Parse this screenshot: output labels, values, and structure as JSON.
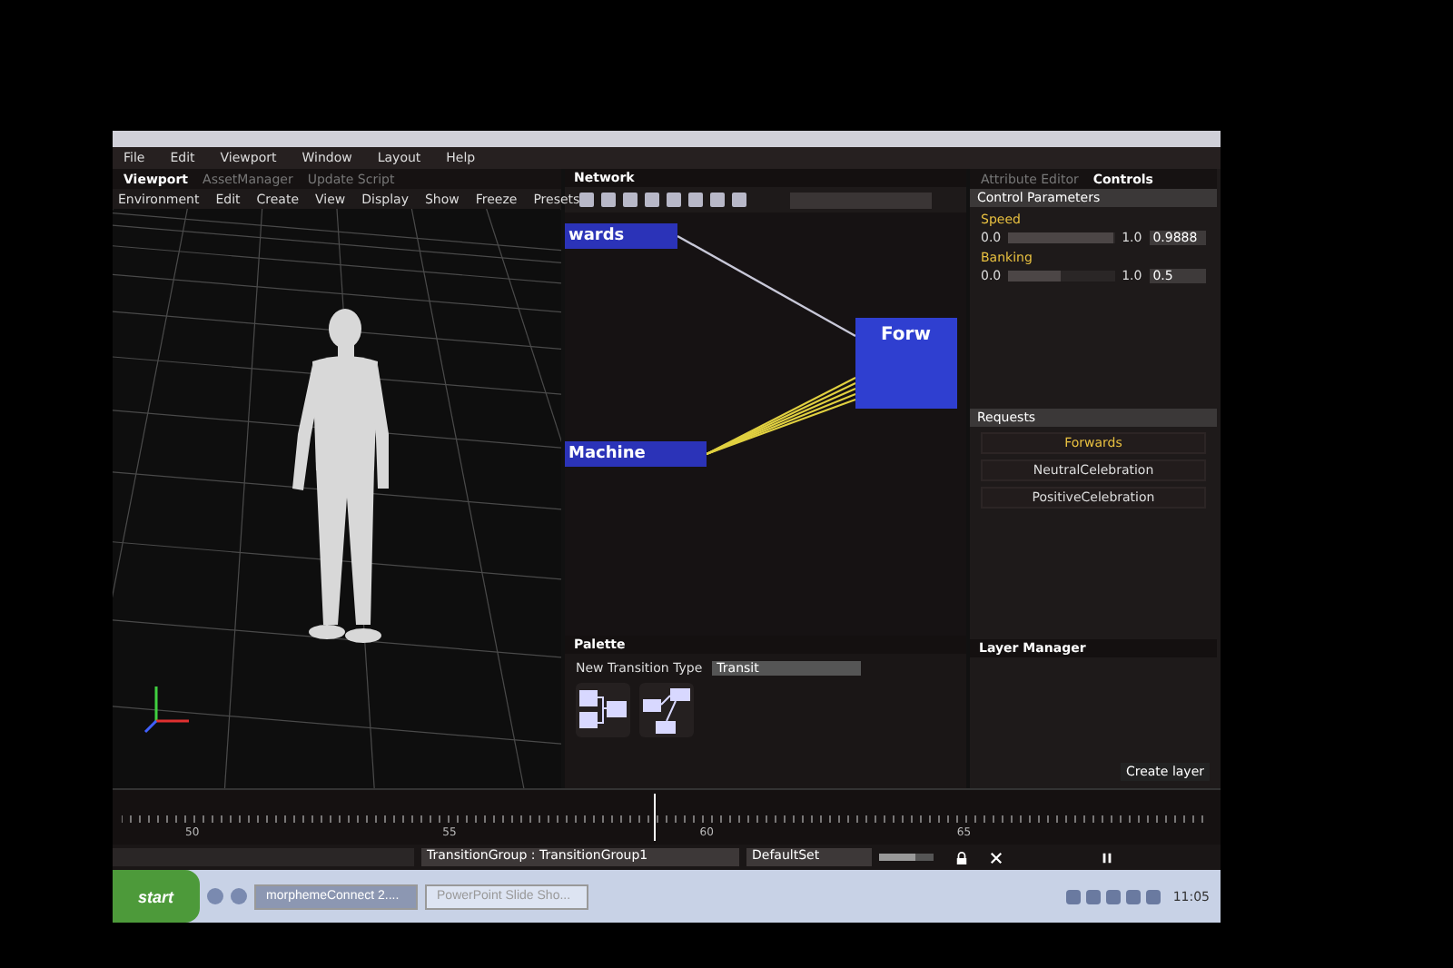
{
  "menu": [
    "File",
    "Edit",
    "Viewport",
    "Window",
    "Layout",
    "Help"
  ],
  "viewport": {
    "tabs": [
      {
        "label": "Viewport",
        "selected": true
      },
      {
        "label": "AssetManager",
        "selected": false
      },
      {
        "label": "Update Script",
        "selected": false
      }
    ],
    "toolbar": [
      "Environment",
      "Edit",
      "Create",
      "View",
      "Display",
      "Show",
      "Freeze",
      "Presets"
    ]
  },
  "network": {
    "title": "Network",
    "nodes": [
      {
        "label": "wards"
      },
      {
        "label": "Machine"
      },
      {
        "label": "Forw"
      }
    ]
  },
  "palette": {
    "title": "Palette",
    "type_label": "New Transition Type",
    "type_value": "Transit"
  },
  "attributes": {
    "tabs": [
      {
        "label": "Attribute Editor",
        "selected": false
      },
      {
        "label": "Controls",
        "selected": true
      }
    ],
    "section": "Control Parameters",
    "params": [
      {
        "name": "Speed",
        "min": "0.0",
        "max": "1.0",
        "level": 0.99,
        "value": "0.9888"
      },
      {
        "name": "Banking",
        "min": "0.0",
        "max": "1.0",
        "level": 0.5,
        "value": "0.5"
      }
    ]
  },
  "requests": {
    "title": "Requests",
    "items": [
      {
        "label": "Forwards",
        "selected": true
      },
      {
        "label": "NeutralCelebration",
        "selected": false
      },
      {
        "label": "PositiveCelebration",
        "selected": false
      }
    ]
  },
  "layer_manager": {
    "title": "Layer Manager",
    "button": "Create layer"
  },
  "timeline": {
    "ticks": [
      "50",
      "55",
      "60",
      "65"
    ]
  },
  "status": {
    "group": "TransitionGroup : TransitionGroup1",
    "set": "DefaultSet",
    "level": 0.65
  },
  "taskbar": {
    "start": "start",
    "tasks": [
      {
        "label": "morphemeConnect 2....",
        "selected": true
      },
      {
        "label": "PowerPoint Slide Sho...",
        "selected": false
      }
    ],
    "time": "11:05"
  }
}
